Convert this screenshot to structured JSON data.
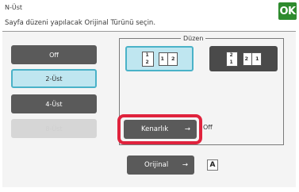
{
  "header": {
    "title": "N-Üst",
    "subtitle": "Sayfa düzeni yapılacak Orijinal Türünü seçin.",
    "ok_label": "OK",
    "ok_color": "#2e8b2e"
  },
  "left_options": [
    {
      "label": "Off",
      "state": "normal"
    },
    {
      "label": "2-Üst",
      "state": "selected"
    },
    {
      "label": "4-Üst",
      "state": "normal"
    },
    {
      "label": "8-Üst",
      "state": "disabled"
    }
  ],
  "layout_group": {
    "label": "Düzen",
    "options": [
      {
        "page_nums": [
          "1",
          "2"
        ],
        "dual": [
          "1",
          "2"
        ],
        "selected": true
      },
      {
        "page_nums": [
          "2",
          "1"
        ],
        "dual": [
          "2",
          "1"
        ],
        "selected": false
      }
    ]
  },
  "border": {
    "button_label": "Kenarlık",
    "arrow": "→",
    "value": "Off"
  },
  "original": {
    "button_label": "Orijinal",
    "arrow": "→",
    "icon_letter": "A"
  },
  "colors": {
    "accent": "#4ab2c8",
    "selected_fill": "#bfe6f0",
    "highlight": "#e0233d",
    "button_dark": "#5a5a5a"
  }
}
